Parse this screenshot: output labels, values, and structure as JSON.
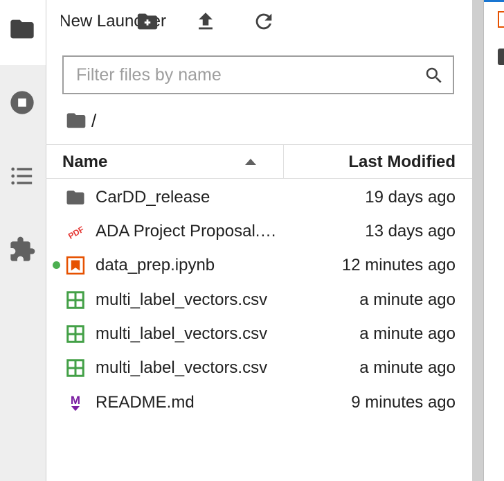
{
  "toolbar": {
    "launcher_tab_label": "New Launcher",
    "new_folder_icon": "new-folder-icon",
    "upload_icon": "upload-icon",
    "refresh_icon": "refresh-icon"
  },
  "sidebar": {
    "items": [
      {
        "name": "file-browser",
        "icon": "folder-icon"
      },
      {
        "name": "running",
        "icon": "stop-circle-icon"
      },
      {
        "name": "table-of-contents",
        "icon": "list-icon"
      },
      {
        "name": "extensions",
        "icon": "puzzle-icon"
      }
    ]
  },
  "search": {
    "placeholder": "Filter files by name",
    "value": ""
  },
  "breadcrumb": {
    "path": "/"
  },
  "header": {
    "name_label": "Name",
    "modified_label": "Last Modified",
    "sort": "ascending"
  },
  "files": [
    {
      "name": "CarDD_release",
      "modified": "19 days ago",
      "type": "folder",
      "running": false
    },
    {
      "name": "ADA Project Proposal.pdf",
      "modified": "13 days ago",
      "type": "pdf",
      "running": false
    },
    {
      "name": "data_prep.ipynb",
      "modified": "12 minutes ago",
      "type": "notebook",
      "running": true
    },
    {
      "name": "multi_label_vectors.csv",
      "modified": "a minute ago",
      "type": "csv",
      "running": false
    },
    {
      "name": "multi_label_vectors.csv",
      "modified": "a minute ago",
      "type": "csv",
      "running": false
    },
    {
      "name": "multi_label_vectors.csv",
      "modified": "a minute ago",
      "type": "csv",
      "running": false
    },
    {
      "name": "README.md",
      "modified": "9 minutes ago",
      "type": "markdown",
      "running": false
    }
  ],
  "colors": {
    "folder": "#616161",
    "pdf": "#e53935",
    "notebook": "#e65100",
    "csv": "#43a047",
    "markdown": "#7b1fa2",
    "running_dot": "#4caf50",
    "accent": "#1976d2"
  }
}
